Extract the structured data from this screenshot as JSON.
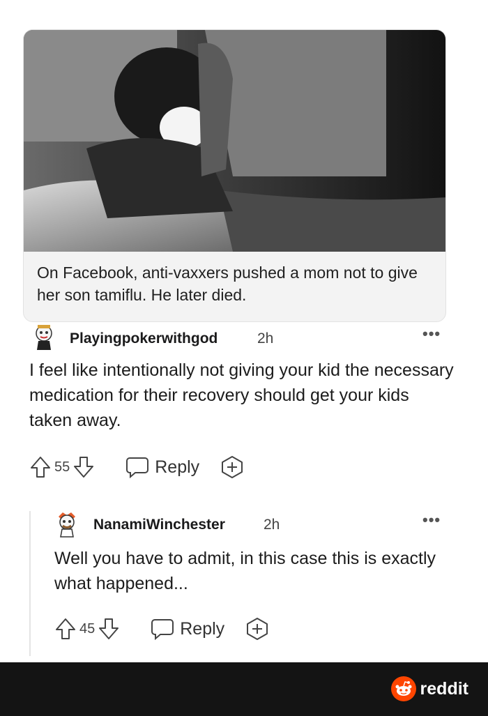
{
  "card": {
    "caption": "On Facebook, anti-vaxxers pushed a mom not to give her son tamiflu. He later died."
  },
  "comments": [
    {
      "username": "Playingpokerwithgod",
      "time": "2h",
      "body": "I feel like intentionally not giving your kid the necessary medication for their recovery should get your kids taken away.",
      "score": "55",
      "reply_label": "Reply"
    },
    {
      "username": "NanamiWinchester",
      "time": "2h",
      "body": "Well you have to admit, in this case this is exactly what happened...",
      "score": "45",
      "reply_label": "Reply"
    }
  ],
  "footer": {
    "brand": "reddit"
  },
  "icons": {
    "more": "more-options-icon",
    "upvote": "upvote-arrow-icon",
    "downvote": "downvote-arrow-icon",
    "reply": "speech-bubble-icon",
    "award": "award-plus-icon",
    "brand": "reddit-snoo-icon"
  }
}
